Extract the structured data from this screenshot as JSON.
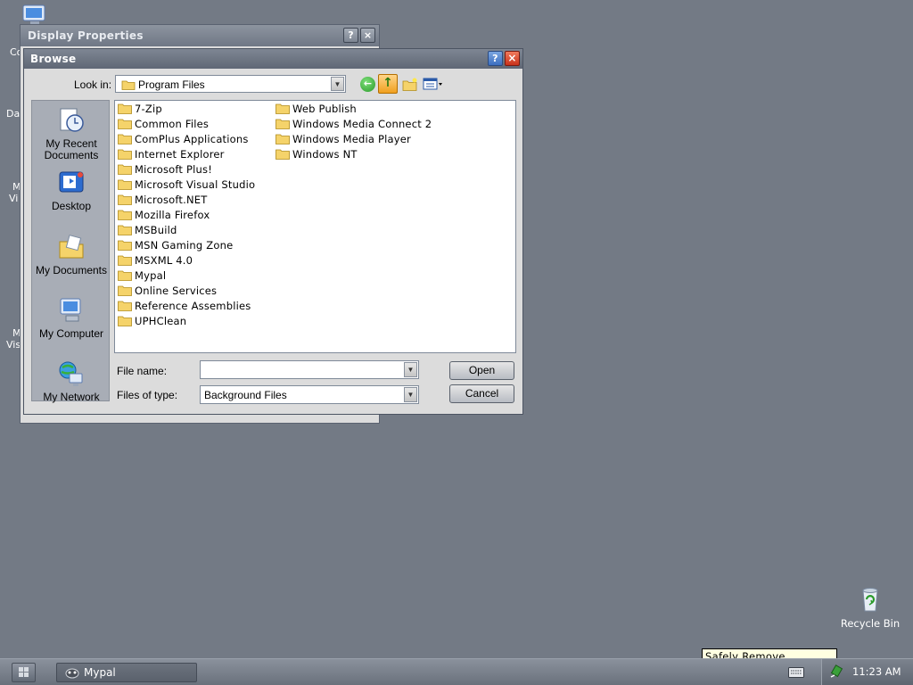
{
  "desktop": {
    "fragments": [
      "Co",
      "Da",
      "M",
      "Vi",
      "M",
      "Vis"
    ],
    "recycle_bin_label": "Recycle Bin"
  },
  "display_properties": {
    "title": "Display Properties",
    "help_glyph": "?",
    "close_glyph": "×"
  },
  "browse": {
    "title": "Browse",
    "help_glyph": "?",
    "close_glyph": "×",
    "look_in_label": "Look in:",
    "look_in_value": "Program Files",
    "toolbar": {
      "back_icon": "back-arrow-icon",
      "up_icon": "up-folder-icon",
      "new_folder_icon": "new-folder-icon",
      "views_icon": "views-menu-icon"
    },
    "places": [
      {
        "label": "My Recent Documents",
        "icon": "recent-documents-icon"
      },
      {
        "label": "Desktop",
        "icon": "desktop-icon"
      },
      {
        "label": "My Documents",
        "icon": "my-documents-icon"
      },
      {
        "label": "My Computer",
        "icon": "my-computer-icon"
      },
      {
        "label": "My Network",
        "icon": "my-network-icon"
      }
    ],
    "folders_col1": [
      "7-Zip",
      "Common Files",
      "ComPlus Applications",
      "Internet Explorer",
      "Microsoft Plus!",
      "Microsoft Visual Studio",
      "Microsoft.NET",
      "Mozilla Firefox",
      "MSBuild",
      "MSN Gaming Zone",
      "MSXML 4.0",
      "Mypal",
      "Online Services",
      "Reference Assemblies",
      "UPHClean"
    ],
    "folders_col2": [
      "Web Publish",
      "Windows Media Connect 2",
      "Windows Media Player",
      "Windows NT"
    ],
    "file_name_label": "File name:",
    "file_name_value": "",
    "files_of_type_label": "Files of type:",
    "files_of_type_value": "Background Files",
    "open_label": "Open",
    "cancel_label": "Cancel"
  },
  "tooltip": "Safely Remove Hardware",
  "taskbar": {
    "task_label": "Mypal",
    "clock": "11:23 AM"
  },
  "colors": {
    "desktop_bg": "#737a85",
    "folder_yellow": "#f5d36a",
    "close_red": "#c8321b",
    "help_blue": "#3d6fc0"
  }
}
